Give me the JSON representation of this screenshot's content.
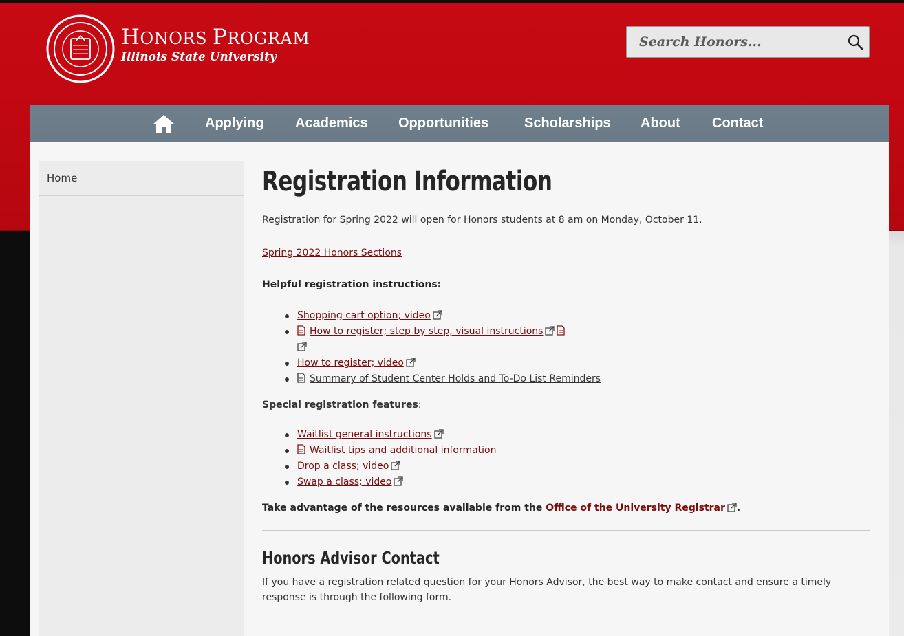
{
  "header": {
    "title": "Honors Program",
    "subtitle": "Illinois State University"
  },
  "search": {
    "placeholder": "Search Honors..."
  },
  "nav": {
    "items": [
      {
        "label": "Applying"
      },
      {
        "label": "Academics"
      },
      {
        "label": "Opportunities"
      },
      {
        "label": "Scholarships"
      },
      {
        "label": "About"
      },
      {
        "label": "Contact"
      }
    ]
  },
  "sidebar": {
    "items": [
      {
        "label": "Home"
      }
    ]
  },
  "main": {
    "title": "Registration Information",
    "intro": "Registration for Spring 2022 will open for Honors students at 8 am on Monday, October 11.",
    "sections_link": "Spring 2022 Honors Sections",
    "helpful_heading": "Helpful registration instructions:",
    "helpful_links": [
      "Shopping cart option; video",
      "How to register; step by step, visual instructions",
      "How to register; video",
      "Summary of Student Center Holds and To-Do List Reminders"
    ],
    "special_heading": "Special registration features",
    "special_colon": ":",
    "special_links": [
      "Waitlist general instructions",
      "Waitlist tips and additional information",
      "Drop a class; video",
      "Swap a class; video"
    ],
    "resources_prefix": "Take advantage of the resources available from the ",
    "resources_link": "Office of the University Registrar",
    "resources_suffix": ".",
    "advisor_heading": "Honors Advisor Contact",
    "advisor_text": "If you have a registration related question for your Honors Advisor, the best way to make contact and ensure a timely response is through the following form."
  },
  "colors": {
    "brand_red": "#c70a14",
    "nav_slate": "#6f7f8c",
    "link": "#7a0d0d"
  },
  "icons": [
    "university-seal-icon",
    "search-icon",
    "home-icon",
    "external-link-icon",
    "document-icon"
  ]
}
